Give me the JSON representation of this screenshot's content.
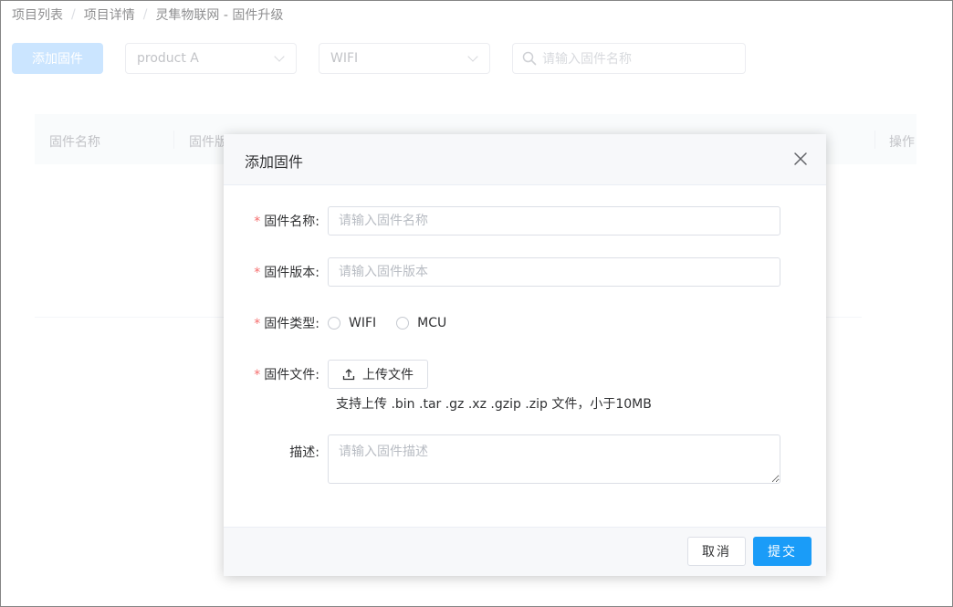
{
  "breadcrumb": {
    "items": [
      "项目列表",
      "项目详情",
      "灵隼物联网 - 固件升级"
    ],
    "separator": "/"
  },
  "toolbar": {
    "add_label": "添加固件",
    "product_select": "product A",
    "type_select": "WIFI",
    "search_placeholder": "请输入固件名称"
  },
  "table": {
    "headers": [
      "固件名称",
      "固件版",
      "操作"
    ]
  },
  "dialog": {
    "title": "添加固件",
    "close_icon": "close-icon",
    "fields": {
      "name_label": "固件名称:",
      "name_placeholder": "请输入固件名称",
      "version_label": "固件版本:",
      "version_placeholder": "请输入固件版本",
      "type_label": "固件类型:",
      "type_options": [
        "WIFI",
        "MCU"
      ],
      "file_label": "固件文件:",
      "upload_label": "上传文件",
      "upload_hint": "支持上传 .bin .tar .gz .xz .gzip .zip 文件，小于10MB",
      "desc_label": "描述:",
      "desc_placeholder": "请输入固件描述"
    },
    "footer": {
      "cancel_label": "取消",
      "submit_label": "提交"
    }
  },
  "colors": {
    "primary": "#1a9cf8",
    "primary_light": "#a0cfff",
    "required": "#f56c6c"
  }
}
